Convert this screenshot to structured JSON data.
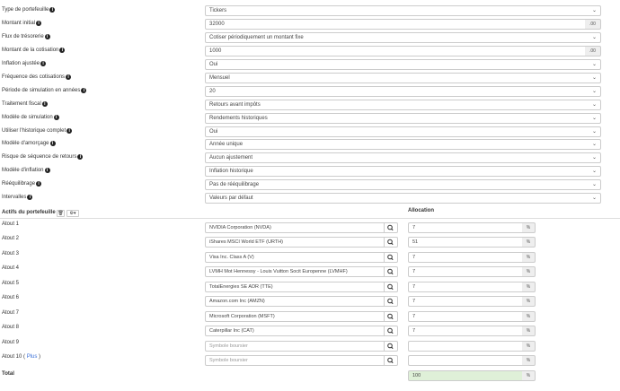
{
  "settings": [
    {
      "label": "Type de portefeuille",
      "value": "Tickers",
      "kind": "select"
    },
    {
      "label": "Montant initial",
      "value": "32000",
      "kind": "input",
      "addon": ".00"
    },
    {
      "label": "Flux de trésorerie",
      "value": "Cotiser périodiquement un montant fixe",
      "kind": "select"
    },
    {
      "label": "Montant de la cotisation",
      "value": "1000",
      "kind": "input",
      "addon": ".00"
    },
    {
      "label": "Inflation ajustée",
      "value": "Oui",
      "kind": "select"
    },
    {
      "label": "Fréquence des cotisations",
      "value": "Mensuel",
      "kind": "select"
    },
    {
      "label": "Période de simulation en années",
      "value": "20",
      "kind": "select"
    },
    {
      "label": "Traitement fiscal",
      "value": "Retours avant impôts",
      "kind": "select"
    },
    {
      "label": "Modèle de simulation",
      "value": "Rendements historiques",
      "kind": "select"
    },
    {
      "label": "Utiliser l'historique complet",
      "value": "Oui",
      "kind": "select"
    },
    {
      "label": "Modèle d'amorçage",
      "value": "Année unique",
      "kind": "select"
    },
    {
      "label": "Risque de séquence de retours",
      "value": "Aucun ajustement",
      "kind": "select"
    },
    {
      "label": "Modèle d'inflation",
      "value": "Inflation historique",
      "kind": "select"
    },
    {
      "label": "Rééquilibrage",
      "value": "Pas de rééquilibrage",
      "kind": "select"
    },
    {
      "label": "Intervalles",
      "value": "Valeurs par défaut",
      "kind": "select"
    }
  ],
  "section": {
    "title": "Actifs du portefeuille",
    "allocation_header": "Allocation",
    "trash_btn": "🗑",
    "gear_btn": "⚙▾"
  },
  "assets": [
    {
      "label": "Atout 1",
      "ticker": "NVIDIA Corporation (NVDA)",
      "alloc": "7"
    },
    {
      "label": "Atout 2",
      "ticker": "iShares MSCI World ETF (URTH)",
      "alloc": "51"
    },
    {
      "label": "Atout 3",
      "ticker": "Visa Inc. Class A (V)",
      "alloc": "7"
    },
    {
      "label": "Atout 4",
      "ticker": "LVMH Mot Hennessy - Louis Vuitton Socit Europenne (LVMHF)",
      "alloc": "7"
    },
    {
      "label": "Atout 5",
      "ticker": "TotalEnergies SE ADR (TTE)",
      "alloc": "7"
    },
    {
      "label": "Atout 6",
      "ticker": "Amazon.com Inc (AMZN)",
      "alloc": "7"
    },
    {
      "label": "Atout 7",
      "ticker": "Microsoft Corporation (MSFT)",
      "alloc": "7"
    },
    {
      "label": "Atout 8",
      "ticker": "Caterpillar Inc (CAT)",
      "alloc": "7"
    },
    {
      "label": "Atout 9",
      "ticker": "",
      "alloc": ""
    },
    {
      "label": "Atout 10",
      "ticker": "",
      "alloc": ""
    }
  ],
  "plus_label": "Plus",
  "ticker_placeholder": "Symbole boursier",
  "percent_sign": "%",
  "total": {
    "label": "Total",
    "value": "100",
    "color": "#dff0d8"
  },
  "icons": {
    "info": "info-icon",
    "search": "search-icon",
    "chevron": "chevron-down-icon"
  }
}
